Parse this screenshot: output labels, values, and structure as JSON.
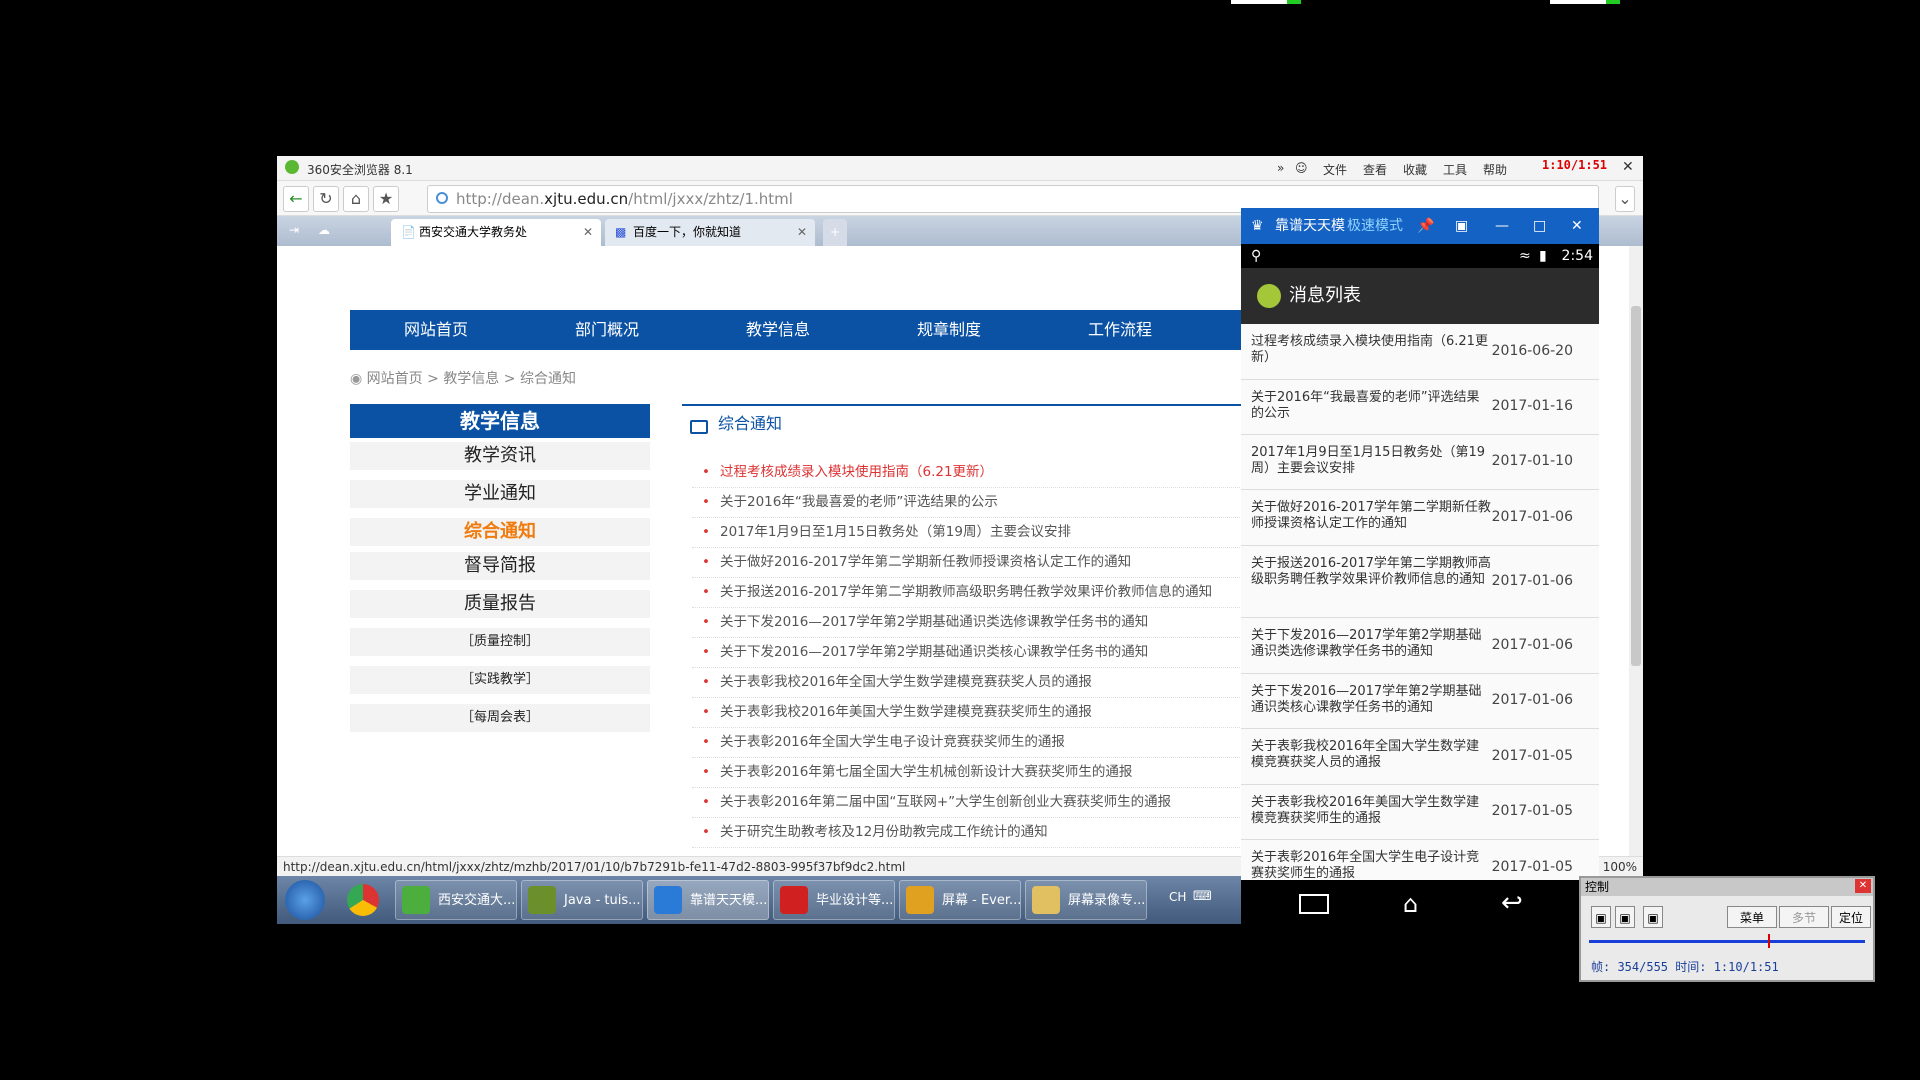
{
  "browser": {
    "title": "360安全浏览器 8.1",
    "menus": [
      "文件",
      "查看",
      "收藏",
      "工具",
      "帮助"
    ],
    "timer": "1:10/1:51",
    "url_prefix": "http://dean.",
    "url_domain": "xjtu.edu.cn",
    "url_path": "/html/jxxx/zhtz/1.html",
    "tabs": [
      {
        "label": "西安交通大学教务处"
      },
      {
        "label": "百度一下，你就知道"
      }
    ],
    "status_url": "http://dean.xjtu.edu.cn/html/jxxx/zhtz/mzhb/2017/01/10/b7b7291b-fe11-47d2-8803-995f37bf9dc2.html",
    "zoom": "100%"
  },
  "site": {
    "nav": [
      "网站首页",
      "部门概况",
      "教学信息",
      "规章制度",
      "工作流程"
    ],
    "breadcrumb": [
      "网站首页",
      "教学信息",
      "综合通知"
    ],
    "sidebar_title": "教学信息",
    "sidebar_items": [
      "教学资讯",
      "学业通知",
      "综合通知",
      "督导简报",
      "质量报告",
      "［质量控制］",
      "［实践教学］",
      "［每周会表］"
    ],
    "content_title": "综合通知",
    "news": [
      "过程考核成绩录入模块使用指南（6.21更新）",
      "关于2016年“我最喜爱的老师”评选结果的公示",
      "2017年1月9日至1月15日教务处（第19周）主要会议安排",
      "关于做好2016-2017学年第二学期新任教师授课资格认定工作的通知",
      "关于报送2016-2017学年第二学期教师高级职务聘任教学效果评价教师信息的通知",
      "关于下发2016—2017学年第2学期基础通识类选修课教学任务书的通知",
      "关于下发2016—2017学年第2学期基础通识类核心课教学任务书的通知",
      "关于表彰我校2016年全国大学生数学建模竞赛获奖人员的通报",
      "关于表彰我校2016年美国大学生数学建模竞赛获奖师生的通报",
      "关于表彰2016年全国大学生电子设计竞赛获奖师生的通报",
      "关于表彰2016年第七届全国大学生机械创新设计大赛获奖师生的通报",
      "关于表彰2016年第二届中国“互联网+”大学生创新创业大赛获奖师生的通报",
      "关于研究生助教考核及12月份助教完成工作统计的通知"
    ]
  },
  "taskbar": {
    "items": [
      {
        "label": "西安交通大...",
        "color": "#4cae3c"
      },
      {
        "label": "Java - tuis...",
        "color": "#6b8f2a"
      },
      {
        "label": "靠谱天天模...",
        "color": "#2a7ad8"
      },
      {
        "label": "毕业设计等...",
        "color": "#d02020"
      },
      {
        "label": "屏幕 - Ever...",
        "color": "#e0a020"
      },
      {
        "label": "屏幕录像专...",
        "color": "#e0c060"
      }
    ],
    "lang": "CH"
  },
  "android": {
    "window_title": "靠谱天天模",
    "window_subtitle": "极速模式",
    "clock": "2:54",
    "app_title": "消息列表",
    "messages": [
      {
        "title": "过程考核成绩录入模块使用指南（6.21更新）",
        "date": "2016-06-20"
      },
      {
        "title": "关于2016年“我最喜爱的老师”评选结果的公示",
        "date": "2017-01-16"
      },
      {
        "title": "2017年1月9日至1月15日教务处（第19周）主要会议安排",
        "date": "2017-01-10"
      },
      {
        "title": "关于做好2016-2017学年第二学期新任教师授课资格认定工作的通知",
        "date": "2017-01-06"
      },
      {
        "title": "关于报送2016-2017学年第二学期教师高级职务聘任教学效果评价教师信息的通知",
        "date": "2017-01-06"
      },
      {
        "title": "关于下发2016—2017学年第2学期基础通识类选修课教学任务书的通知",
        "date": "2017-01-06"
      },
      {
        "title": "关于下发2016—2017学年第2学期基础通识类核心课教学任务书的通知",
        "date": "2017-01-06"
      },
      {
        "title": "关于表彰我校2016年全国大学生数学建模竞赛获奖人员的通报",
        "date": "2017-01-05"
      },
      {
        "title": "关于表彰我校2016年美国大学生数学建模竞赛获奖师生的通报",
        "date": "2017-01-05"
      },
      {
        "title": "关于表彰2016年全国大学生电子设计竞赛获奖师生的通报",
        "date": "2017-01-05"
      }
    ]
  },
  "control": {
    "title": "控制",
    "buttons": [
      "菜单",
      "多节",
      "定位"
    ],
    "status": "帧: 354/555 时间: 1:10/1:51",
    "progress": 0.65
  }
}
